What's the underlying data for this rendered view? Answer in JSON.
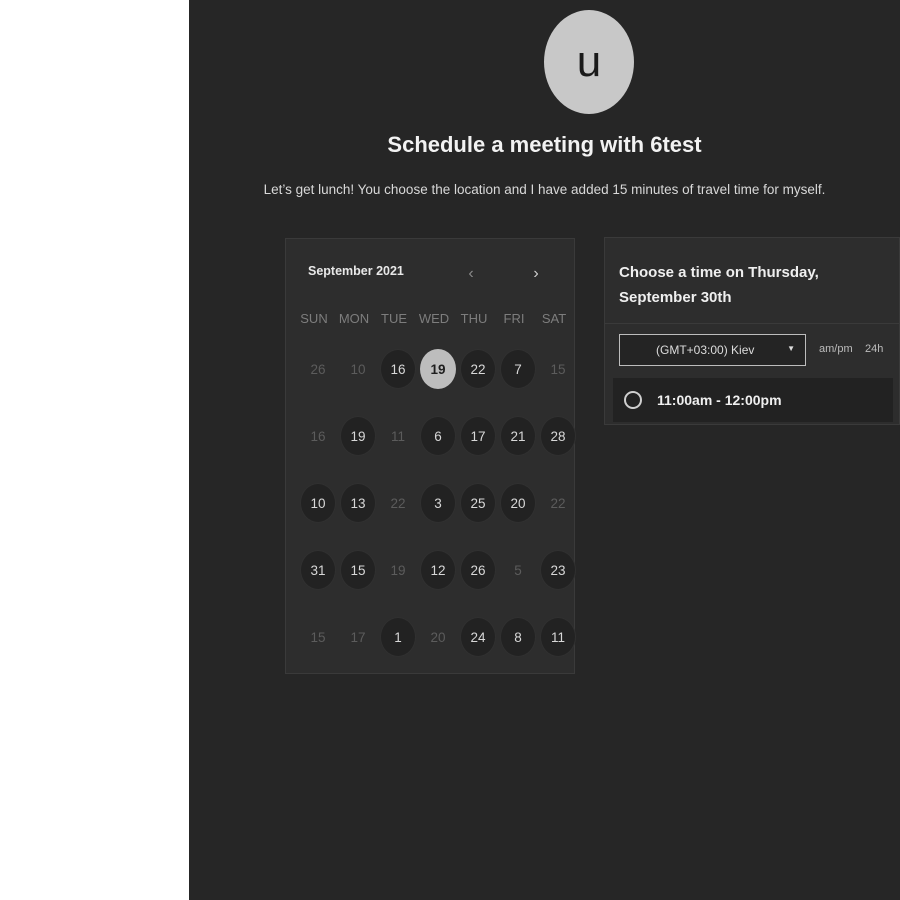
{
  "header": {
    "avatar_letter": "u",
    "title": "Schedule a meeting with 6test",
    "description": "Let’s get lunch! You choose the location and I have added 15 minutes of travel time for myself."
  },
  "calendar": {
    "month_label": "September 2021",
    "prev_icon": "chevron-left-icon",
    "next_icon": "chevron-right-icon",
    "days_of_week": [
      "SUN",
      "MON",
      "TUE",
      "WED",
      "THU",
      "FRI",
      "SAT"
    ],
    "weeks": [
      [
        {
          "d": "26",
          "s": "unavailable"
        },
        {
          "d": "10",
          "s": "unavailable"
        },
        {
          "d": "16",
          "s": "available"
        },
        {
          "d": "19",
          "s": "selected"
        },
        {
          "d": "22",
          "s": "available"
        },
        {
          "d": "7",
          "s": "available"
        },
        {
          "d": "15",
          "s": "unavailable"
        }
      ],
      [
        {
          "d": "16",
          "s": "unavailable"
        },
        {
          "d": "19",
          "s": "available"
        },
        {
          "d": "11",
          "s": "unavailable"
        },
        {
          "d": "6",
          "s": "available"
        },
        {
          "d": "17",
          "s": "available"
        },
        {
          "d": "21",
          "s": "available"
        },
        {
          "d": "28",
          "s": "available"
        }
      ],
      [
        {
          "d": "10",
          "s": "available"
        },
        {
          "d": "13",
          "s": "available"
        },
        {
          "d": "22",
          "s": "unavailable"
        },
        {
          "d": "3",
          "s": "available"
        },
        {
          "d": "25",
          "s": "available"
        },
        {
          "d": "20",
          "s": "available"
        },
        {
          "d": "22",
          "s": "unavailable"
        }
      ],
      [
        {
          "d": "31",
          "s": "available"
        },
        {
          "d": "15",
          "s": "available"
        },
        {
          "d": "19",
          "s": "unavailable"
        },
        {
          "d": "12",
          "s": "available"
        },
        {
          "d": "26",
          "s": "available"
        },
        {
          "d": "5",
          "s": "unavailable"
        },
        {
          "d": "23",
          "s": "available"
        }
      ],
      [
        {
          "d": "15",
          "s": "unavailable"
        },
        {
          "d": "17",
          "s": "unavailable"
        },
        {
          "d": "1",
          "s": "available"
        },
        {
          "d": "20",
          "s": "unavailable"
        },
        {
          "d": "24",
          "s": "available"
        },
        {
          "d": "8",
          "s": "available"
        },
        {
          "d": "11",
          "s": "available"
        }
      ]
    ]
  },
  "time_panel": {
    "title": "Choose a time on Thursday, September 30th",
    "timezone_value": "(GMT+03:00) Kiev",
    "format_ampm": "am/pm",
    "format_24": "24h",
    "slots": [
      {
        "label": "11:00am - 12:00pm"
      }
    ]
  },
  "colors": {
    "background": "#262626",
    "panel": "#2d2d2d",
    "selected_day": "#bdbdbd",
    "avatar": "#c8c8c8"
  }
}
